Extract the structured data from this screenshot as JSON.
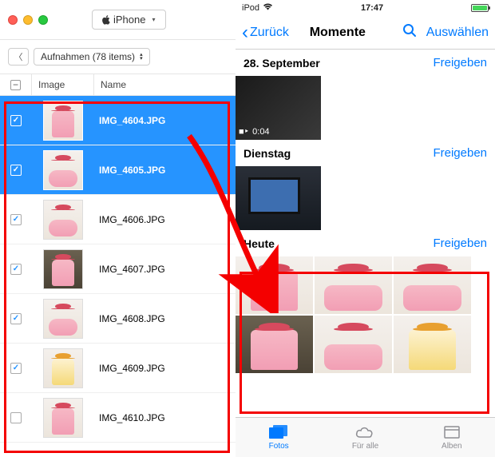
{
  "mac": {
    "device_label": "iPhone",
    "breadcrumb_label": "Aufnahmen (78 items)",
    "columns": {
      "image": "Image",
      "name": "Name"
    },
    "files": [
      {
        "name": "IMG_4604.JPG",
        "checked": true,
        "selected": true,
        "style": "cake"
      },
      {
        "name": "IMG_4605.JPG",
        "checked": true,
        "selected": true,
        "style": "cake flat"
      },
      {
        "name": "IMG_4606.JPG",
        "checked": true,
        "selected": false,
        "style": "cake flat"
      },
      {
        "name": "IMG_4607.JPG",
        "checked": true,
        "selected": false,
        "style": "cake dark"
      },
      {
        "name": "IMG_4608.JPG",
        "checked": true,
        "selected": false,
        "style": "cake flat"
      },
      {
        "name": "IMG_4609.JPG",
        "checked": true,
        "selected": false,
        "style": "cake yellow"
      },
      {
        "name": "IMG_4610.JPG",
        "checked": false,
        "selected": false,
        "style": "cake"
      }
    ]
  },
  "ios": {
    "carrier": "iPod",
    "time": "17:47",
    "back_label": "Zurück",
    "title": "Momente",
    "select_label": "Auswählen",
    "share_label": "Freigeben",
    "sections": [
      {
        "title": "28. September",
        "type": "video",
        "duration": "0:04"
      },
      {
        "title": "Dienstag",
        "type": "image"
      },
      {
        "title": "Heute",
        "type": "grid",
        "tiles": [
          "cake",
          "cake flat",
          "cake flat",
          "cake dark",
          "cake flat",
          "cake yellow"
        ]
      }
    ],
    "tabs": {
      "photos": "Fotos",
      "shared": "Für alle",
      "albums": "Alben"
    }
  }
}
